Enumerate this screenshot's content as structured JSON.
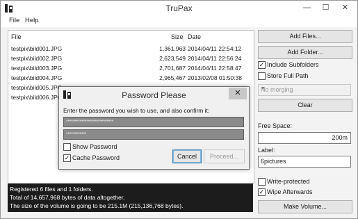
{
  "window": {
    "title": "TruPax",
    "controls": {
      "minimize": "—",
      "maximize": "☐",
      "close": "✕"
    }
  },
  "menu": [
    "File",
    "Help"
  ],
  "file_table": {
    "columns": {
      "file": "File",
      "size": "Size",
      "date": "Date"
    },
    "rows": [
      {
        "file": "testpix\\bild001.JPG",
        "size": "1,361,963",
        "date": "2014/04/11 22:54:12"
      },
      {
        "file": "testpix\\bild002.JPG",
        "size": "2,623,549",
        "date": "2014/04/11 22:56:24"
      },
      {
        "file": "testpix\\bild003.JPG",
        "size": "2,701,687",
        "date": "2014/04/11 22:58:47"
      },
      {
        "file": "testpix\\bild004.JPG",
        "size": "2,965,467",
        "date": "2013/02/08 01:50:38"
      },
      {
        "file": "testpix\\bild005.JPG",
        "size": "",
        "date": ""
      },
      {
        "file": "testpix\\bild006.JPG",
        "size": "",
        "date": ""
      }
    ]
  },
  "status": {
    "lines": [
      "Registered 6 files and 1 folders.",
      "Total of 14,657,968 bytes of data altogether.",
      "The size of the volume is going to be 215.1M (215,136,768 bytes)."
    ]
  },
  "side": {
    "add_files": "Add Files...",
    "add_folder": "Add Folder...",
    "include_subfolders": {
      "label": "Include Subfolders",
      "checked": true
    },
    "store_full_path": {
      "label": "Store Full Path",
      "checked": false
    },
    "merging": {
      "value": "No merging"
    },
    "clear": "Clear",
    "free_space": {
      "label": "Free Space:",
      "value": "200m"
    },
    "volume_label": {
      "label": "Label:",
      "value": "6pictures"
    },
    "write_protected": {
      "label": "Write-protected",
      "checked": false
    },
    "wipe_afterwards": {
      "label": "Wipe Afterwards",
      "checked": true
    },
    "make_volume": "Make Volume..."
  },
  "dialog": {
    "title": "Password Please",
    "close": "✕",
    "prompt": "Enter the password you wish to use, and also confirm it:",
    "password_mask": "****************************",
    "confirm_mask": "************",
    "show_password": {
      "label": "Show Password",
      "checked": false
    },
    "cache_password": {
      "label": "Cache Password",
      "checked": true
    },
    "cancel": "Cancel",
    "proceed": "Proceed..."
  },
  "check_mark": "✓"
}
